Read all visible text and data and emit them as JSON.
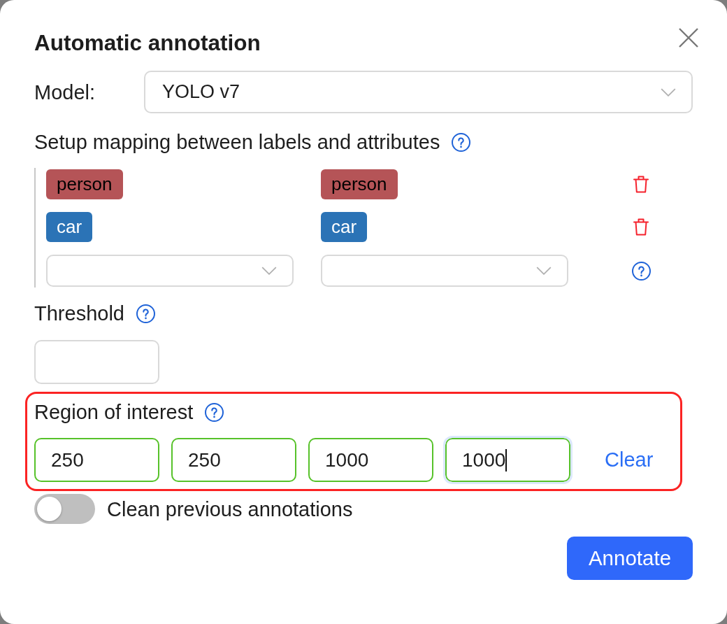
{
  "dialog": {
    "title": "Automatic annotation"
  },
  "model": {
    "label": "Model:",
    "value": "YOLO v7"
  },
  "mapping": {
    "title": "Setup mapping between labels and attributes",
    "rows": [
      {
        "kind": "pair",
        "model_label": {
          "text": "person",
          "color": "#b55457"
        },
        "task_label": {
          "text": "person",
          "color": "#b55457"
        }
      },
      {
        "kind": "pair",
        "model_label": {
          "text": "car",
          "color": "#2b73b6"
        },
        "task_label": {
          "text": "car",
          "color": "#2b73b6"
        }
      },
      {
        "kind": "new"
      }
    ]
  },
  "threshold": {
    "label": "Threshold"
  },
  "region_of_interest": {
    "label": "Region of interest",
    "highlighted": true,
    "fields": [
      {
        "value": "250",
        "valid": true,
        "focused": false
      },
      {
        "value": "250",
        "valid": true,
        "focused": false
      },
      {
        "value": "1000",
        "valid": true,
        "focused": false
      },
      {
        "value": "1000",
        "valid": true,
        "focused": true
      }
    ],
    "clear": "Clear"
  },
  "clean_previous": {
    "label": "Clean previous annotations",
    "on": false
  },
  "buttons": [
    "Annotate"
  ]
}
